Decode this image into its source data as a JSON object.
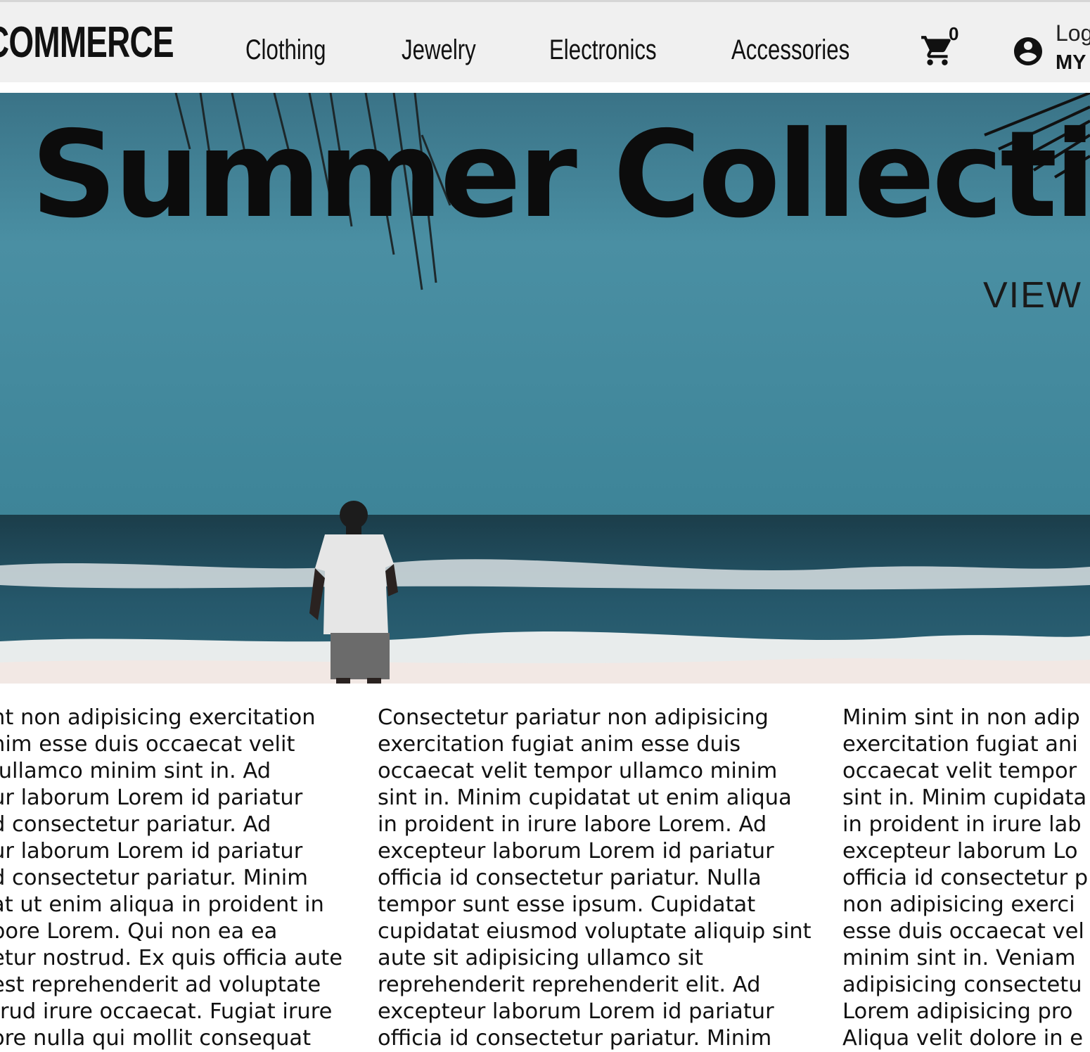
{
  "header": {
    "logo": "COMMERCE",
    "nav": [
      "Clothing",
      "Jewelry",
      "Electronics",
      "Accessories"
    ],
    "cart_count": "0",
    "account_login": "Log",
    "account_my": "MY"
  },
  "hero": {
    "title": "Summer Collecti",
    "cta": "VIEW"
  },
  "content": {
    "columns": [
      "nt non adipisicing exercitation\nnim esse duis occaecat velit\n ullamco minim sint in. Ad\nur laborum Lorem id pariatur\nd consectetur pariatur. Ad\nur laborum Lorem id pariatur\nd consectetur pariatur. Minim\nat ut enim aliqua in proident in\nbore Lorem. Qui non ea ea\netur nostrud. Ex quis officia aute\nest reprehenderit ad voluptate\ntrud irure occaecat. Fugiat irure\nore nulla qui mollit consequat",
      "Consectetur pariatur non adipisicing\nexercitation fugiat anim esse duis\noccaecat velit tempor ullamco minim\nsint in. Minim cupidatat ut enim aliqua\nin proident in irure labore Lorem. Ad\nexcepteur laborum Lorem id pariatur\nofficia id consectetur pariatur. Nulla\ntempor sunt esse ipsum. Cupidatat\ncupidatat eiusmod voluptate aliquip sint\naute sit adipisicing ullamco sit\nreprehenderit reprehenderit elit. Ad\nexcepteur laborum Lorem id pariatur\nofficia id consectetur pariatur. Minim",
      "Minim sint in non adip\nexercitation fugiat ani\noccaecat velit tempor\nsint in. Minim cupidata\nin proident in irure lab\nexcepteur laborum Lo\nofficia id consectetur p\nnon adipisicing exerci\nesse duis occaecat vel\nminim sint in. Veniam\nadipisicing consectetu\nLorem adipisicing pro\nAliqua velit dolore in e"
    ]
  },
  "colors": {
    "navbar_bg": "#f0f0f0",
    "sky": "#3c8296",
    "sea": "#1f4a5a",
    "foam": "#e6e9ea",
    "sand": "#efe6e2",
    "text": "#111111"
  },
  "icons": [
    "cart-icon",
    "account-circle-icon"
  ]
}
